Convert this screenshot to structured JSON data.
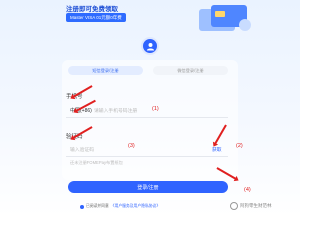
{
  "banner": {
    "title": "注册即可免费领取",
    "badge": "Master VISA 01元额0年费"
  },
  "tabs": [
    {
      "label": "短信登录/注册"
    },
    {
      "label": "微信登录/注册"
    }
  ],
  "phone": {
    "label": "手机号",
    "prefix": "中国(+86)",
    "placeholder": "请输入手机号码注册"
  },
  "code": {
    "label": "验证码",
    "placeholder": "输入验证码",
    "get_code": "获取",
    "hint": "还未注册FOMEPay布置纸包"
  },
  "login_button": "登录/注册",
  "agreement": {
    "prefix": "已阅读并同意",
    "link": "《用户服务及用户隐私协议》"
  },
  "annotations": [
    "(1)",
    "(2)",
    "(3)",
    "(4)"
  ],
  "watermark": "阿狗零生财范林",
  "colors": {
    "accent": "#2f63ff",
    "annotation": "#e02020"
  }
}
